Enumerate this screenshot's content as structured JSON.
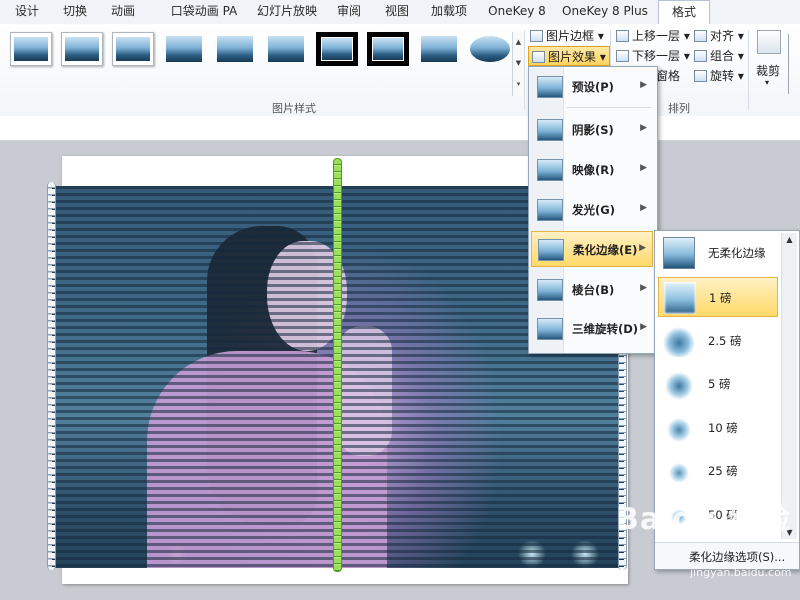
{
  "tabs": [
    {
      "label": "设计"
    },
    {
      "label": "切换"
    },
    {
      "label": "动画"
    },
    {
      "label": "口袋动画 PA"
    },
    {
      "label": "幻灯片放映"
    },
    {
      "label": "审阅"
    },
    {
      "label": "视图"
    },
    {
      "label": "加载项"
    },
    {
      "label": "OneKey 8"
    },
    {
      "label": "OneKey 8 Plus"
    },
    {
      "label": "格式",
      "active": true
    }
  ],
  "ribbon": {
    "picture_styles_label": "图片样式",
    "arrange_label": "排列",
    "border_btn": "图片边框",
    "effects_btn": "图片效果",
    "bring_forward": "上移一层",
    "send_backward": "下移一层",
    "selection_pane": "窗格",
    "align": "对齐",
    "group": "组合",
    "rotate": "旋转",
    "crop": "裁剪"
  },
  "effects_menu": {
    "items": [
      {
        "label": "预设(P)"
      },
      {
        "label": "阴影(S)"
      },
      {
        "label": "映像(R)"
      },
      {
        "label": "发光(G)"
      },
      {
        "label": "柔化边缘(E)",
        "active": true
      },
      {
        "label": "棱台(B)"
      },
      {
        "label": "三维旋转(D)"
      }
    ]
  },
  "soft_edges_submenu": {
    "items": [
      {
        "label": "无柔化边缘"
      },
      {
        "label": "1 磅",
        "active": true
      },
      {
        "label": "2.5 磅"
      },
      {
        "label": "5 磅"
      },
      {
        "label": "10 磅"
      },
      {
        "label": "25 磅"
      },
      {
        "label": "50 磅"
      }
    ],
    "footer": "柔化边缘选项(S)..."
  },
  "watermark": {
    "brand": "Baidu 经验",
    "url": "jingyan.baidu.com"
  }
}
